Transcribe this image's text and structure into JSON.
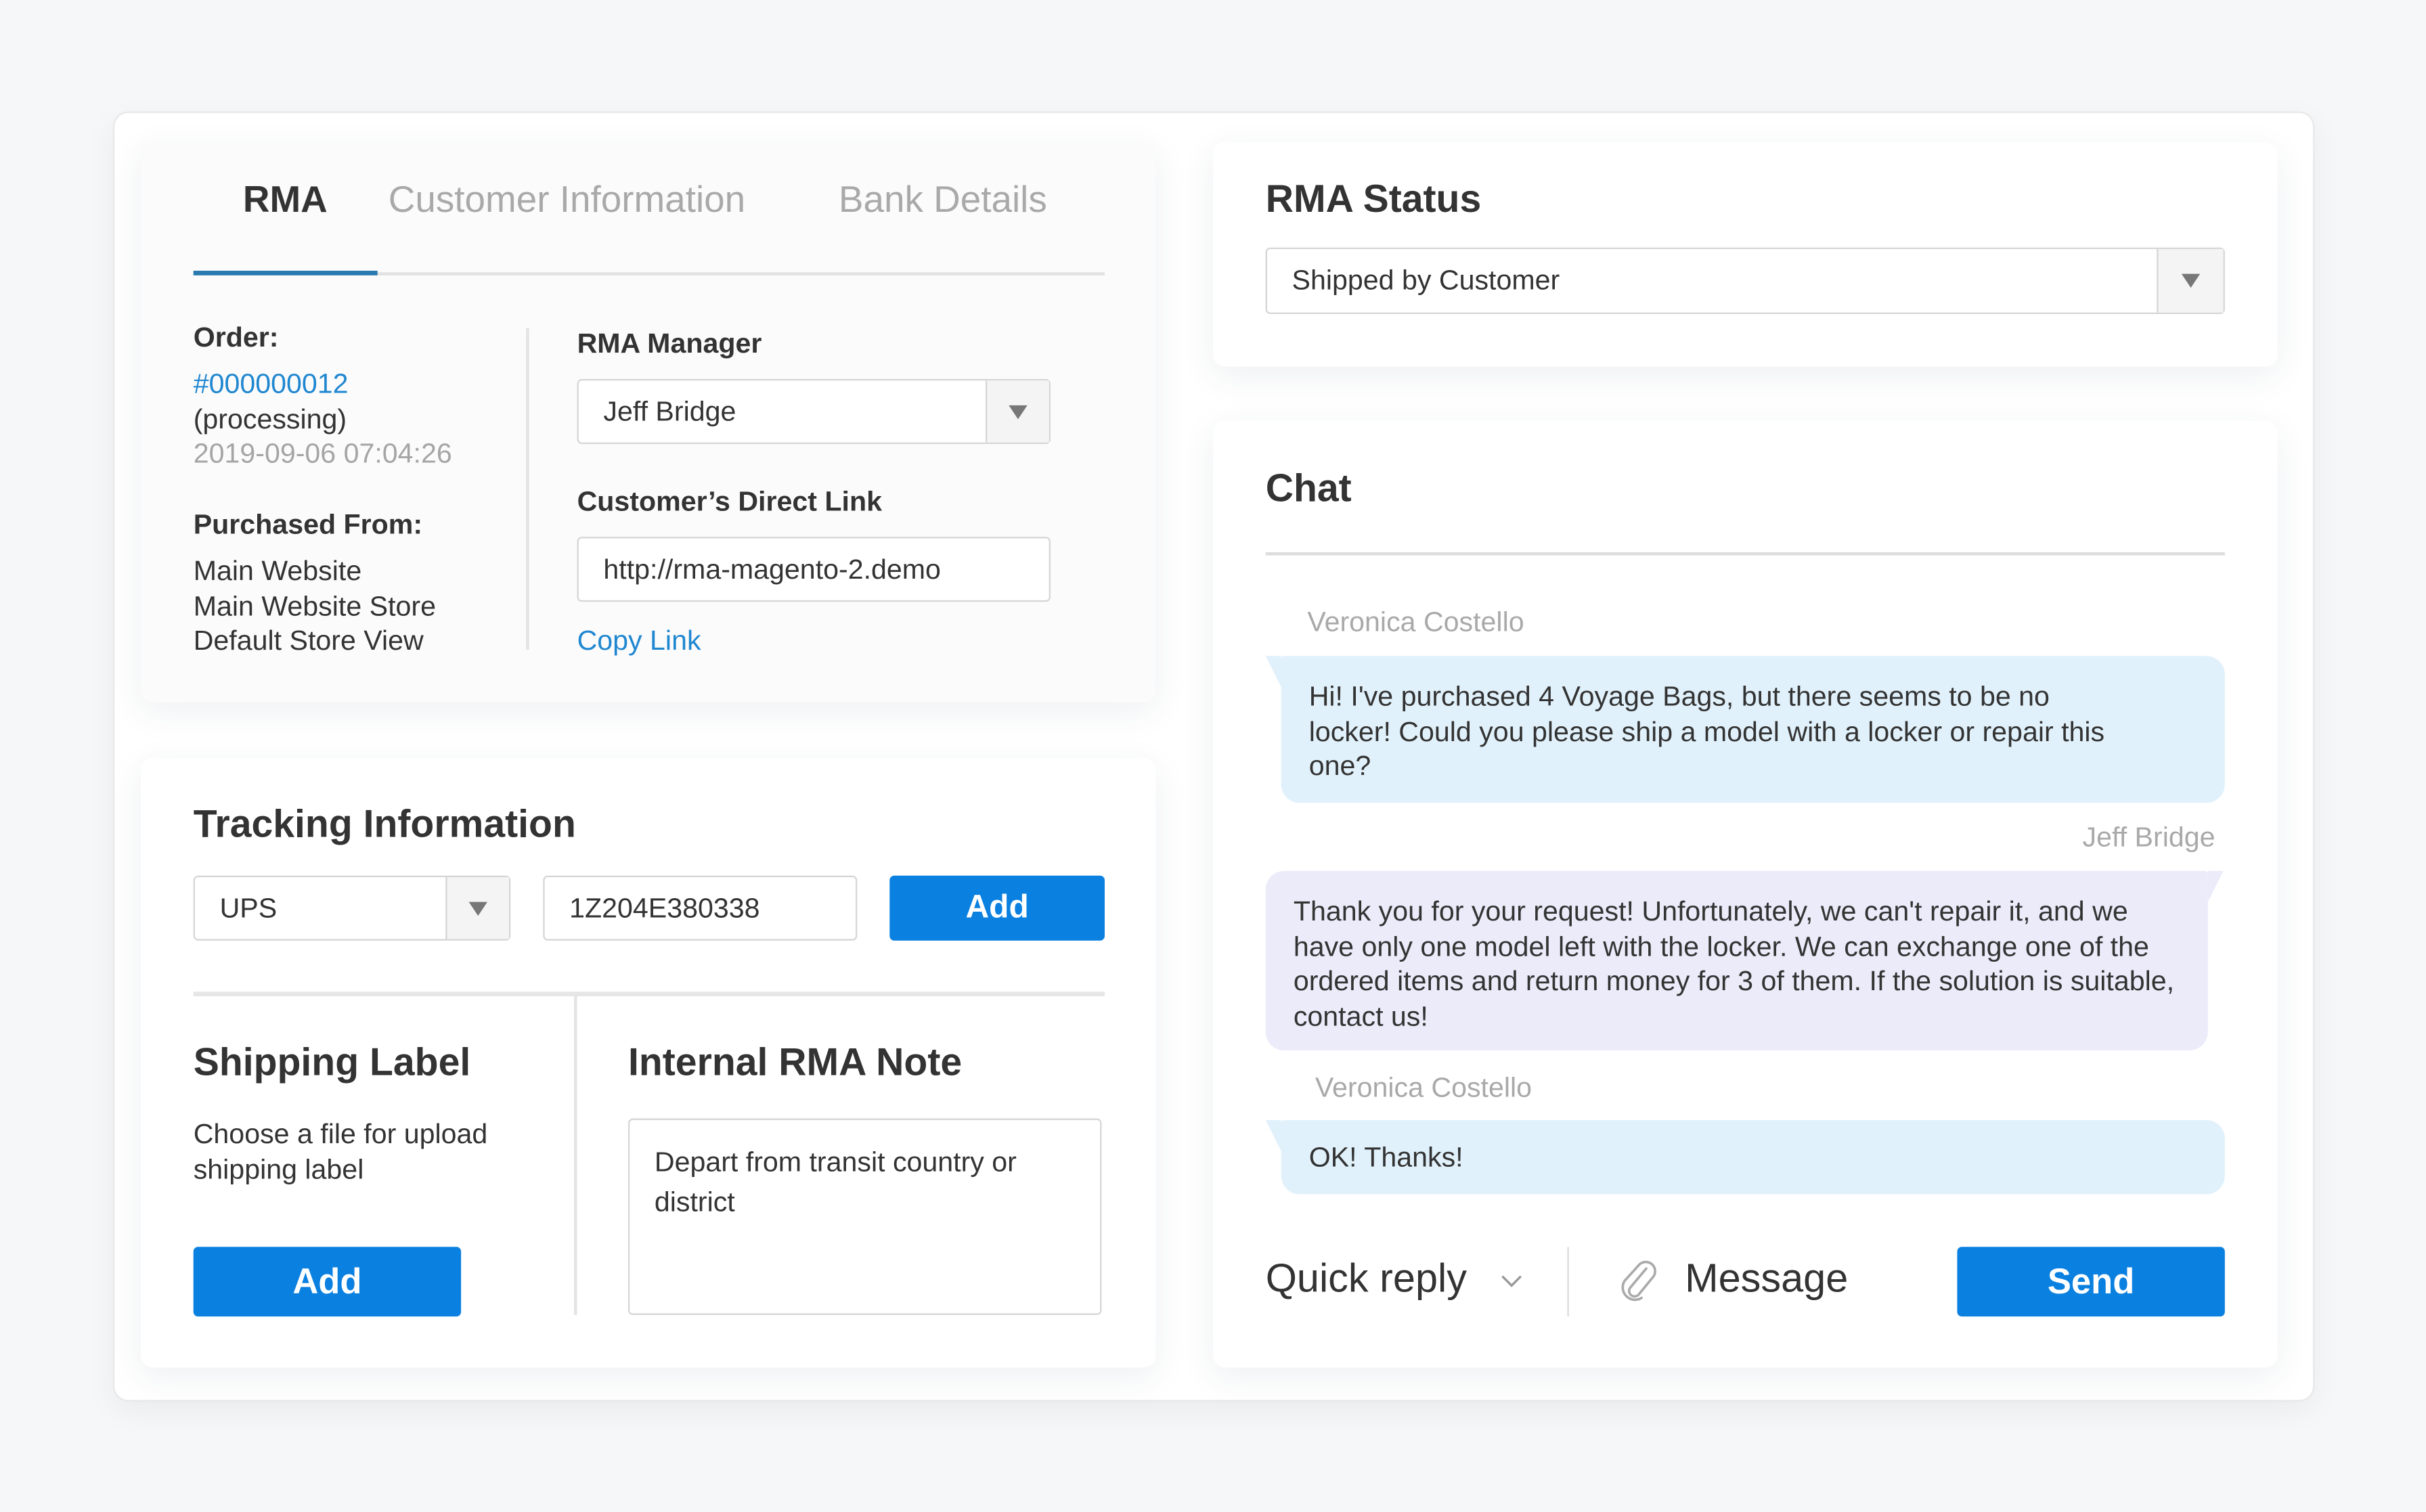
{
  "tabs": [
    {
      "label": "RMA",
      "active": true
    },
    {
      "label": "Customer Information",
      "active": false
    },
    {
      "label": "Bank Details",
      "active": false
    }
  ],
  "order": {
    "label": "Order:",
    "number": "#000000012",
    "status": "(processing)",
    "date": "2019-09-06 07:04:26"
  },
  "purchased_from": {
    "label": "Purchased From:",
    "lines": [
      "Main Website",
      "Main Website Store",
      "Default Store View"
    ]
  },
  "rma_manager": {
    "label": "RMA Manager",
    "selected": "Jeff Bridge"
  },
  "direct_link": {
    "label": "Customer’s Direct Link",
    "value": "http://rma-magento-2.demo",
    "copy_label": "Copy Link"
  },
  "tracking": {
    "title": "Tracking Information",
    "carrier": "UPS",
    "number": "1Z204E380338",
    "add_label": "Add"
  },
  "shipping_label": {
    "title": "Shipping Label",
    "description": "Choose a file for upload shipping label",
    "add_label": "Add"
  },
  "internal_note": {
    "title": "Internal RMA Note",
    "text": "Depart from transit country or district"
  },
  "rma_status": {
    "title": "RMA Status",
    "selected": "Shipped by Customer"
  },
  "chat": {
    "title": "Chat",
    "messages": [
      {
        "sender": "Veronica Costello",
        "role": "customer",
        "text": "Hi! I've purchased 4 Voyage Bags, but there seems to be no locker! Could you please ship a model with a locker or repair this one?"
      },
      {
        "sender": "Jeff Bridge",
        "role": "agent",
        "text": "Thank you for your request! Unfortunately, we can't repair it, and we have only one model left with the locker. We can exchange one of the ordered items and return money for 3 of them. If the solution is suitable, contact us!"
      },
      {
        "sender": "Veronica Costello",
        "role": "customer",
        "text": "OK! Thanks!"
      }
    ],
    "quick_reply_label": "Quick reply",
    "message_placeholder": "Message",
    "send_label": "Send"
  },
  "colors": {
    "accent": "#0a80e0",
    "link": "#1f87d0",
    "tab_active_underline": "#2a7ab0",
    "customer_bubble": "#e1f1fb",
    "agent_bubble": "#ebebfa"
  }
}
